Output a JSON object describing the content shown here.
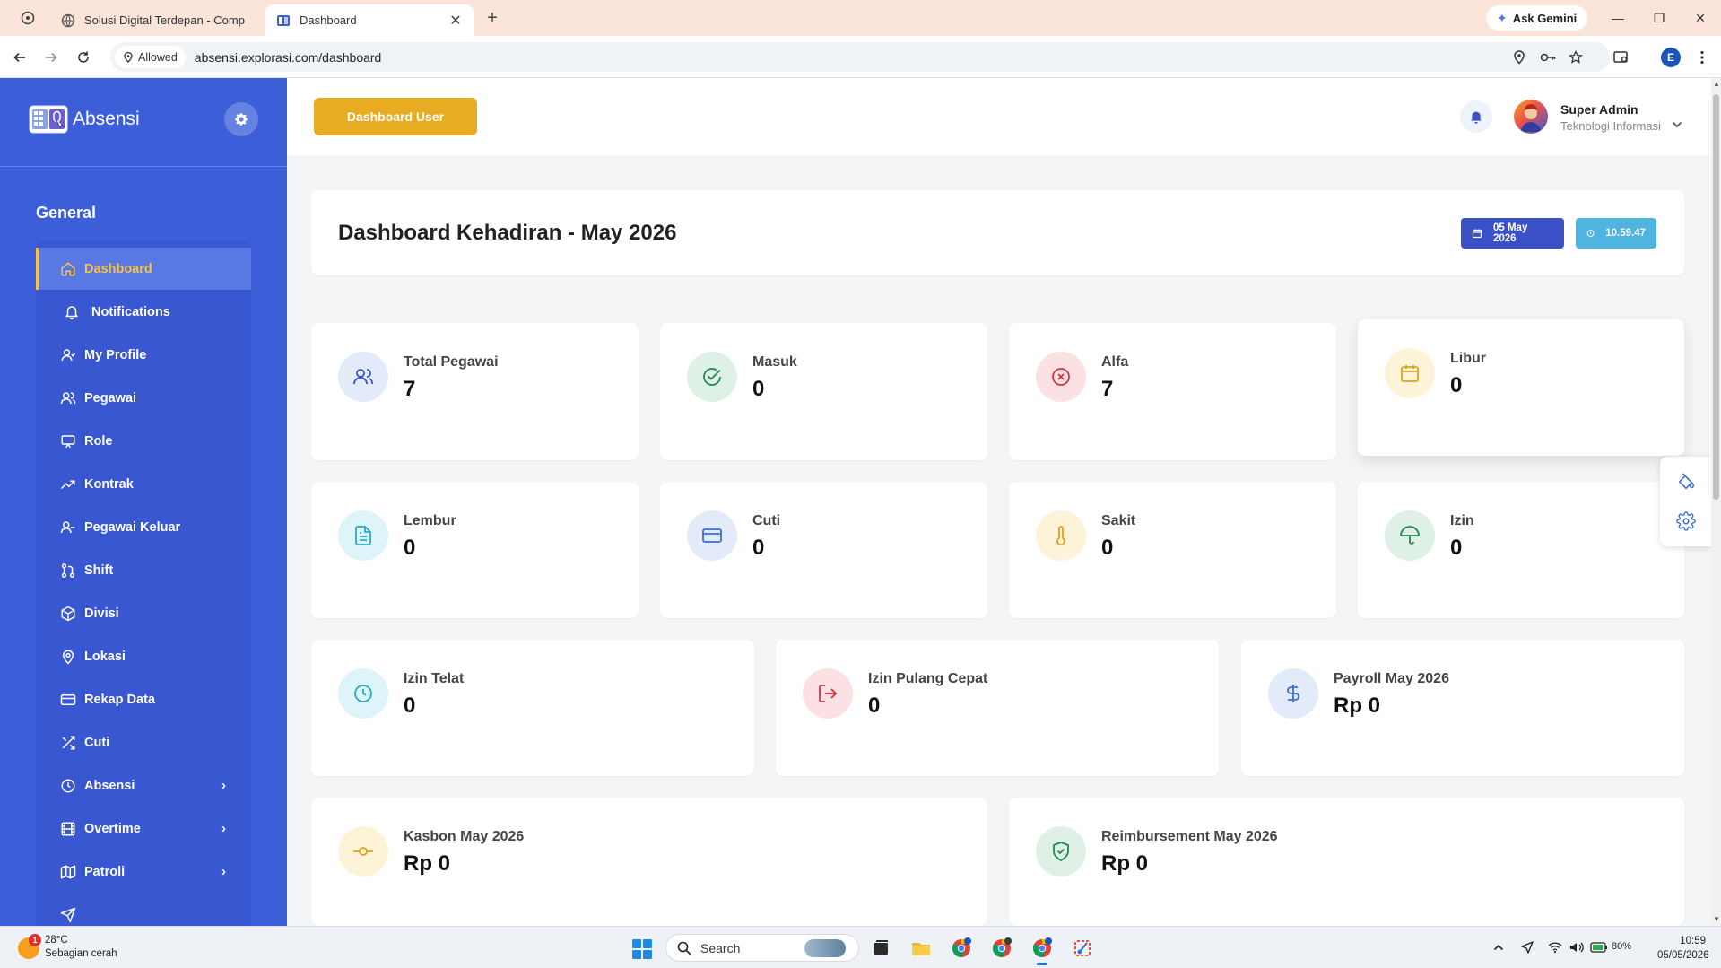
{
  "browser": {
    "tabs": [
      {
        "title": "Solusi Digital Terdepan - Comp",
        "active": false
      },
      {
        "title": "Dashboard",
        "active": true
      }
    ],
    "gemini_label": "Ask Gemini",
    "permission_chip": "Allowed",
    "url": "absensi.explorasi.com/dashboard",
    "profile_initial": "E"
  },
  "sidebar": {
    "brand": "Absensi",
    "section_title": "General",
    "items": [
      {
        "label": "Dashboard",
        "icon": "home-icon",
        "active": true
      },
      {
        "label": "Notifications",
        "icon": "bell-icon"
      },
      {
        "label": "My Profile",
        "icon": "user-icon"
      },
      {
        "label": "Pegawai",
        "icon": "users-icon"
      },
      {
        "label": "Role",
        "icon": "monitor-icon"
      },
      {
        "label": "Kontrak",
        "icon": "trending-up-icon"
      },
      {
        "label": "Pegawai Keluar",
        "icon": "user-minus-icon"
      },
      {
        "label": "Shift",
        "icon": "git-pull-icon"
      },
      {
        "label": "Divisi",
        "icon": "box-icon"
      },
      {
        "label": "Lokasi",
        "icon": "map-pin-icon"
      },
      {
        "label": "Rekap Data",
        "icon": "credit-card-icon"
      },
      {
        "label": "Cuti",
        "icon": "shuffle-icon"
      },
      {
        "label": "Absensi",
        "icon": "clock-icon",
        "has_children": true
      },
      {
        "label": "Overtime",
        "icon": "film-icon",
        "has_children": true
      },
      {
        "label": "Patroli",
        "icon": "map-icon",
        "has_children": true
      }
    ]
  },
  "topbar": {
    "dashboard_user_button": "Dashboard User",
    "user_name": "Super Admin",
    "user_dept": "Teknologi Informasi"
  },
  "header": {
    "title": "Dashboard Kehadiran - May 2026",
    "date": "05 May 2026",
    "time": "10.59.47"
  },
  "stats": {
    "total_pegawai": {
      "label": "Total Pegawai",
      "value": "7"
    },
    "masuk": {
      "label": "Masuk",
      "value": "0"
    },
    "alfa": {
      "label": "Alfa",
      "value": "7"
    },
    "libur": {
      "label": "Libur",
      "value": "0"
    },
    "lembur": {
      "label": "Lembur",
      "value": "0"
    },
    "cuti": {
      "label": "Cuti",
      "value": "0"
    },
    "sakit": {
      "label": "Sakit",
      "value": "0"
    },
    "izin": {
      "label": "Izin",
      "value": "0"
    },
    "izin_telat": {
      "label": "Izin Telat",
      "value": "0"
    },
    "izin_pulang_cepat": {
      "label": "Izin Pulang Cepat",
      "value": "0"
    },
    "payroll": {
      "label": "Payroll May 2026",
      "value": "Rp 0"
    },
    "kasbon": {
      "label": "Kasbon May 2026",
      "value": "Rp 0"
    },
    "reimbursement": {
      "label": "Reimbursement May 2026",
      "value": "Rp 0"
    }
  },
  "taskbar": {
    "weather_badge": "1",
    "temperature": "28°C",
    "weather_desc": "Sebagian cerah",
    "search_placeholder": "Search",
    "battery": "80%",
    "time": "10:59",
    "date": "05/05/2026"
  },
  "colors": {
    "sidebar": "#3c5fd9",
    "accent_yellow": "#e7ac22",
    "date_pill": "#3a51c8",
    "time_pill": "#4fb4e0"
  }
}
